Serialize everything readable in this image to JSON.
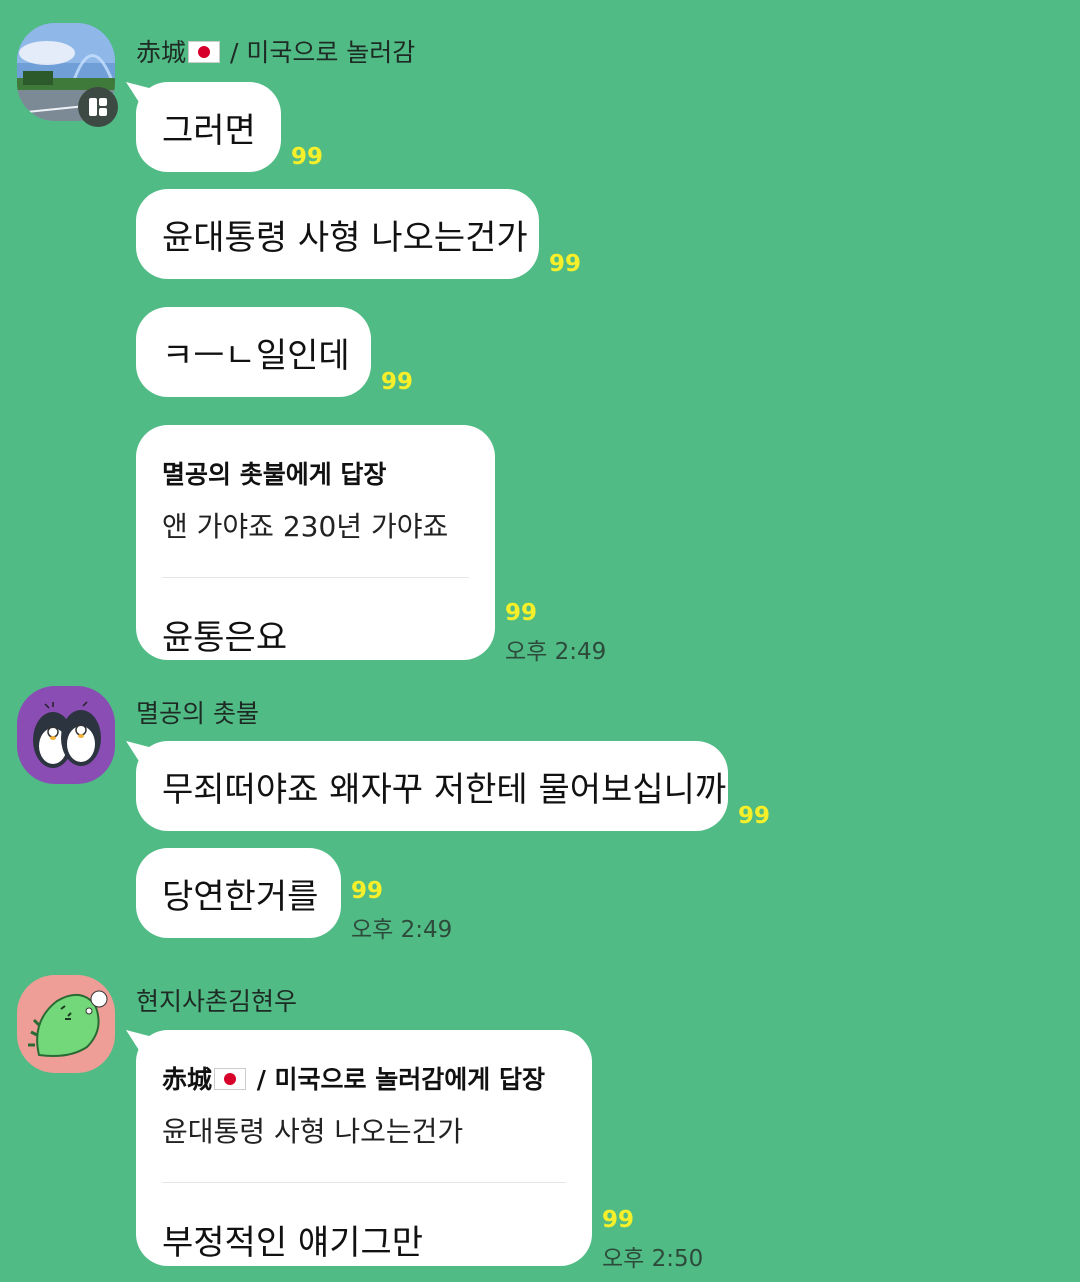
{
  "messages": [
    {
      "sender_name_prefix": "赤城",
      "sender_name_suffix": " / 미국으로 놀러감",
      "items": [
        {
          "text": "그러면",
          "unread": "99"
        },
        {
          "text": "윤대통령 사형 나오는건가",
          "unread": "99"
        },
        {
          "text": "ㅋㅡㄴ일인데",
          "unread": "99"
        },
        {
          "reply_to": "멸공의 촛불에게 답장",
          "quoted": "앤 가야죠 230년 가야죠",
          "text": "윤통은요",
          "unread": "99",
          "time": "오후 2:49"
        }
      ]
    },
    {
      "sender_name": "멸공의 촛불",
      "items": [
        {
          "text": "무죄떠야죠 왜자꾸 저한테 물어보십니까",
          "unread": "99"
        },
        {
          "text": "당연한거를",
          "unread": "99",
          "time": "오후 2:49"
        }
      ]
    },
    {
      "sender_name": "현지사촌김현우",
      "items": [
        {
          "reply_to_prefix": "赤城",
          "reply_to_suffix": " / 미국으로 놀러감에게 답장",
          "quoted": "윤대통령 사형 나오는건가",
          "text": "부정적인 얘기그만",
          "unread": "99",
          "time": "오후 2:50"
        }
      ]
    }
  ],
  "colors": {
    "background": "#50bb85",
    "bubble": "#ffffff",
    "unread": "#f7ef2a",
    "time": "#2d4a3a"
  },
  "icons": [
    "profile-photo-landscape",
    "profile-penguins",
    "profile-green-dino",
    "flag-japan-icon",
    "multi-profile-badge-icon"
  ]
}
